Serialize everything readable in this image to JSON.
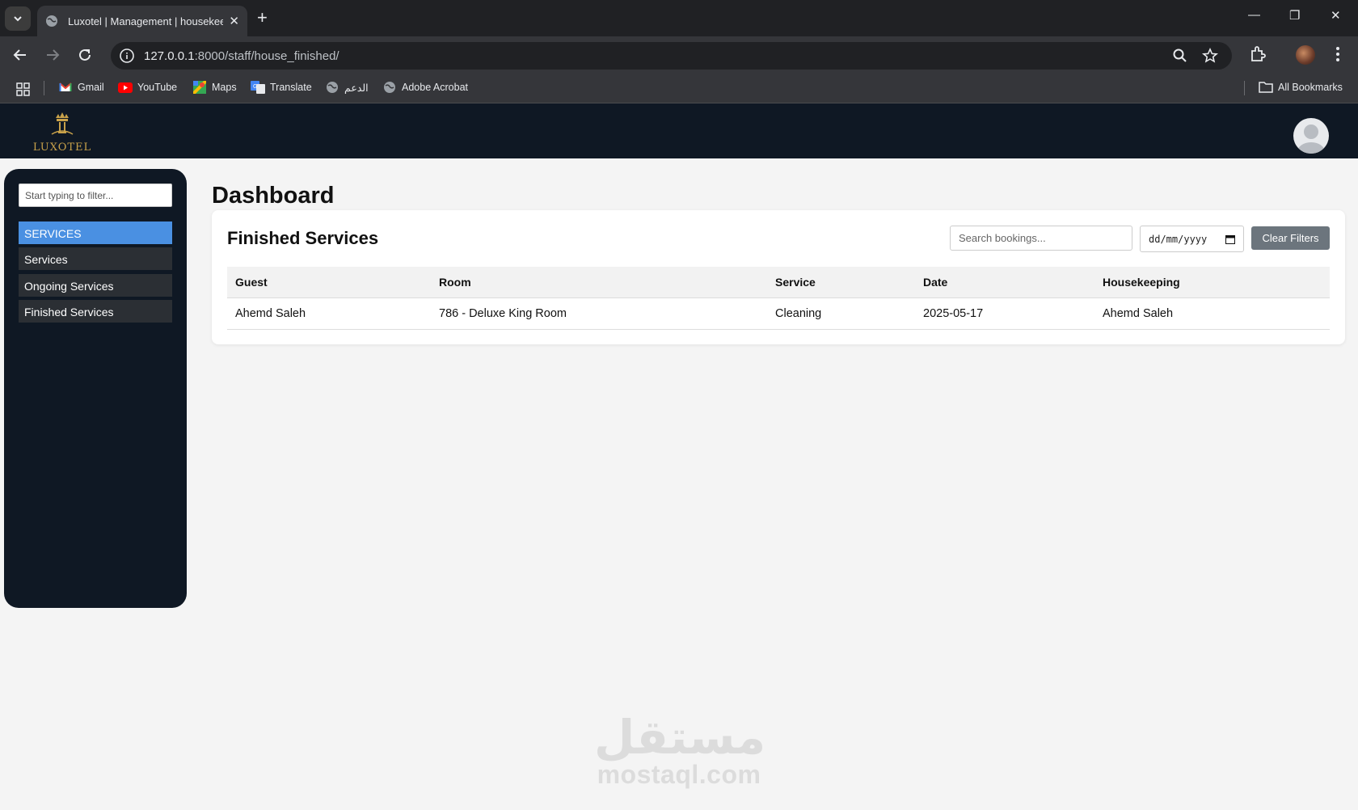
{
  "browser": {
    "tab_title": "Luxotel | Management | housekeeping",
    "url_host": "127.0.0.1",
    "url_path": ":8000/staff/house_finished/",
    "bookmarks": [
      {
        "label": "Gmail",
        "icon": "gmail-icon"
      },
      {
        "label": "YouTube",
        "icon": "youtube-icon"
      },
      {
        "label": "Maps",
        "icon": "maps-icon"
      },
      {
        "label": "Translate",
        "icon": "translate-icon"
      },
      {
        "label": "الدعم",
        "icon": "globe-icon"
      },
      {
        "label": "Adobe Acrobat",
        "icon": "globe-icon"
      }
    ],
    "all_bookmarks": "All Bookmarks"
  },
  "app": {
    "brand": "LUXOTEL",
    "brand_color": "#c9a24a",
    "header_bg": "#0f1824"
  },
  "sidebar": {
    "filter_placeholder": "Start typing to filter...",
    "section_header": "SERVICES",
    "items": [
      {
        "label": "Services"
      },
      {
        "label": "Ongoing Services"
      },
      {
        "label": "Finished Services"
      }
    ],
    "active_color": "#4a90e2"
  },
  "main": {
    "page_title": "Dashboard",
    "card_title": "Finished Services",
    "search_placeholder": "Search bookings...",
    "date_placeholder": "dd/mm/yyyy",
    "clear_filters": "Clear Filters",
    "table": {
      "columns": [
        "Guest",
        "Room",
        "Service",
        "Date",
        "Housekeeping"
      ],
      "rows": [
        [
          "Ahemd Saleh",
          "786 - Deluxe King Room",
          "Cleaning",
          "2025-05-17",
          "Ahemd Saleh"
        ]
      ]
    }
  },
  "watermark": {
    "arabic": "مستقل",
    "latin": "mostaql.com"
  }
}
